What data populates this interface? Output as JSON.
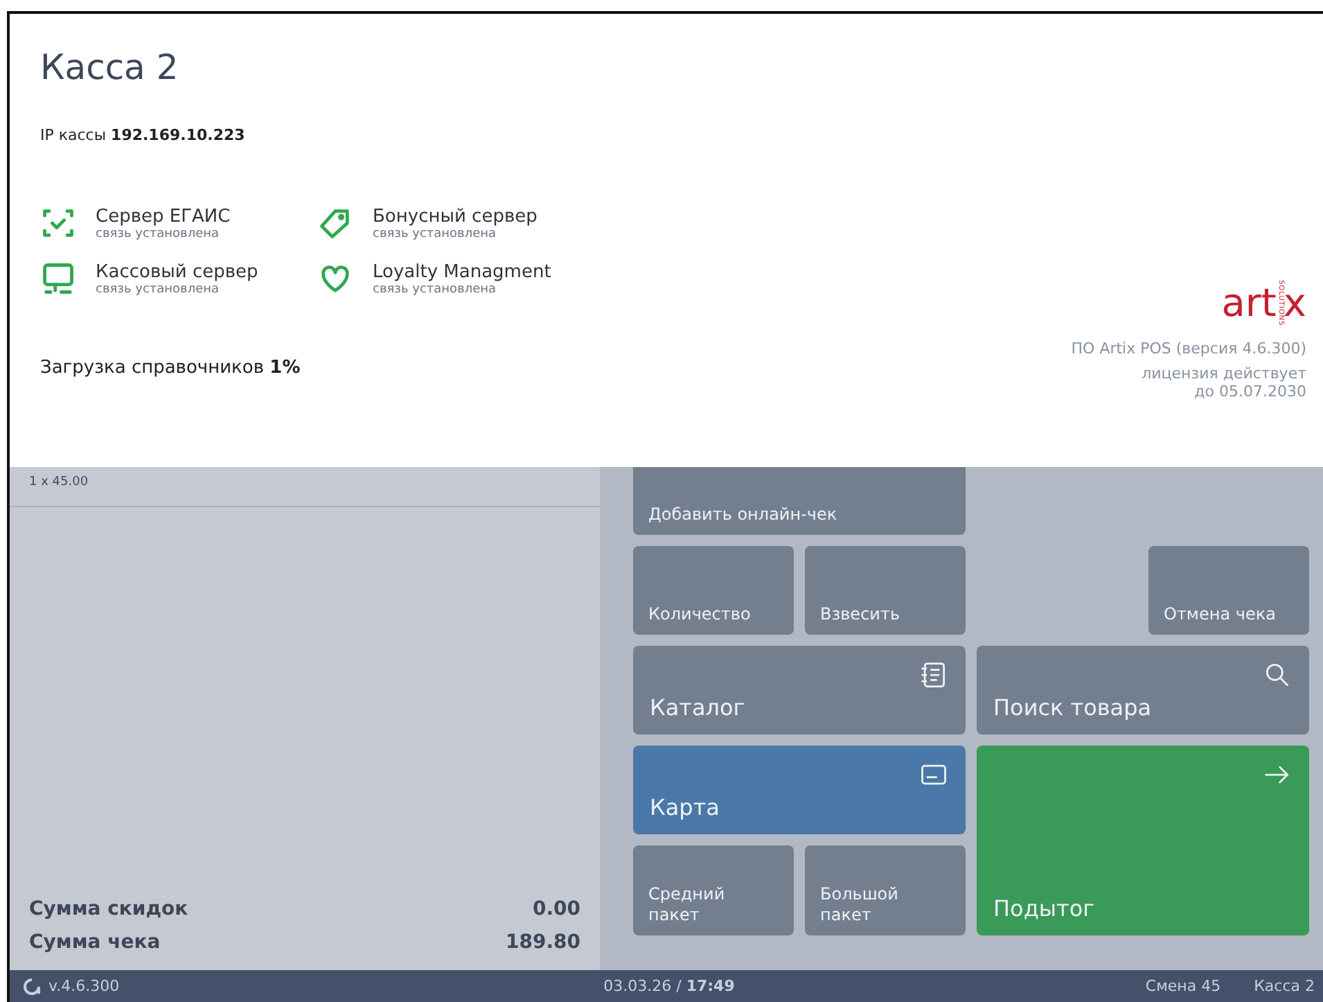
{
  "header": {
    "title": "Касса 2",
    "ip_label": "IP кассы",
    "ip_value": "192.169.10.223"
  },
  "services": [
    {
      "name": "Сервер ЕГАИС",
      "status": "связь установлена",
      "connected": true
    },
    {
      "name": "Бонусный сервер",
      "status": "связь установлена",
      "connected": true
    },
    {
      "name": "Кассовый сервер",
      "status": "связь установлена",
      "connected": true
    },
    {
      "name": "Loyalty Managment",
      "status": "связь установлена",
      "connected": true
    }
  ],
  "loading": {
    "label": "Загрузка справочников",
    "value": "1%"
  },
  "logo": {
    "left": "art",
    "right": "x",
    "tagline": "SOLUTIONS"
  },
  "product": {
    "version": "ПО Artix POS (версия 4.6.300)",
    "license": "лицензия действует",
    "license_date": "до 05.07.2030"
  },
  "receipt": {
    "items": [
      "1 x 45.00"
    ],
    "totals": [
      {
        "label": "Сумма скидок",
        "value": "0.00"
      },
      {
        "label": "Сумма чека",
        "value": "189.80"
      }
    ]
  },
  "buttons": [
    {
      "label": "Добавить онлайн-чек",
      "kind": "plain"
    },
    {
      "label": "Количество",
      "kind": "plain"
    },
    {
      "label": "Взвесить",
      "kind": "plain"
    },
    {
      "label": "Отмена чека",
      "kind": "plain"
    },
    {
      "label": "Каталог",
      "kind": "wide"
    },
    {
      "label": "Поиск товара",
      "kind": "wide"
    },
    {
      "label": "Карта",
      "kind": "card"
    },
    {
      "label": "Средний пакет",
      "kind": "plain"
    },
    {
      "label": "Большой пакет",
      "kind": "plain"
    },
    {
      "label": "Подытог",
      "kind": "subtotal"
    }
  ],
  "status_bar": {
    "version": "v.4.6.300",
    "date": "03.03.26",
    "separator": "/",
    "time": "17:49",
    "shift": "Смена 45",
    "register": "Касса 2"
  }
}
